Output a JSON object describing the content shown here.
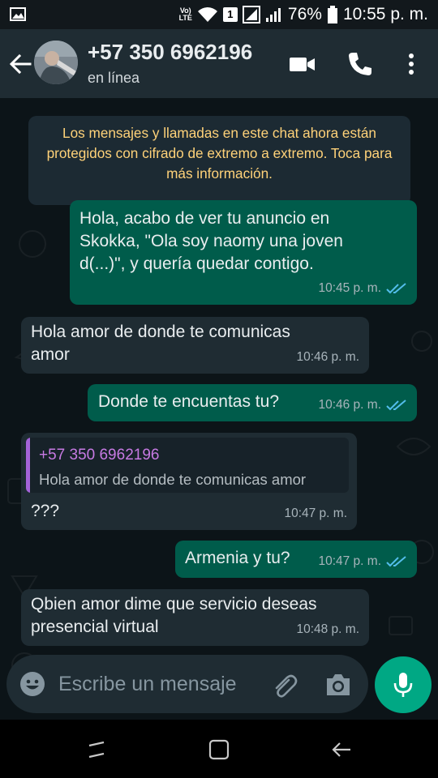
{
  "status_bar": {
    "volte_top": "Vo)",
    "volte_bottom": "LTE",
    "sim_number": "1",
    "battery": "76%",
    "time": "10:55 p. m."
  },
  "header": {
    "contact": "+57 350 6962196",
    "status": "en línea"
  },
  "chat": {
    "encryption_notice": "Los mensajes y llamadas en este chat ahora están protegidos con cifrado de extremo a extremo. Toca para más información.",
    "messages": [
      {
        "direction": "out",
        "lines": [
          "Hola, acabo de ver tu anuncio en",
          "Skokka, \"Ola soy naomy una joven",
          "d(...)\", y quería quedar contigo."
        ],
        "time": "10:45 p. m.",
        "read": true
      },
      {
        "direction": "in",
        "lines": [
          "Hola amor de donde te comunicas",
          "amor"
        ],
        "time": "10:46 p. m."
      },
      {
        "direction": "out",
        "text": "Donde te encuentas tu?",
        "time": "10:46 p. m.",
        "read": true
      },
      {
        "direction": "in",
        "quote_author": "+57 350 6962196",
        "quote_text": "Hola amor de donde te comunicas amor",
        "text": "???",
        "time": "10:47 p. m."
      },
      {
        "direction": "out",
        "text": "Armenia y tu?",
        "time": "10:47 p. m.",
        "read": true
      },
      {
        "direction": "in",
        "lines": [
          "Qbien amor dime que servicio deseas",
          "presencial virtual"
        ],
        "time": "10:48 p. m."
      }
    ]
  },
  "composer": {
    "placeholder": "Escribe un mensaje"
  },
  "icons": {
    "back": "arrow-left-icon",
    "video": "videocam-icon",
    "call": "phone-icon",
    "menu": "more-vert-icon",
    "emoji": "emoji-icon",
    "attach": "paperclip-icon",
    "camera": "camera-icon",
    "mic": "mic-icon"
  },
  "colors": {
    "header": "#1f2c33",
    "outgoing_bubble": "#005c4b",
    "incoming_bubble": "#1f2c33",
    "notice_text": "#ffd279",
    "accent": "#00a884",
    "read_ticks": "#53bdeb",
    "quote_accent": "#a463d9"
  }
}
